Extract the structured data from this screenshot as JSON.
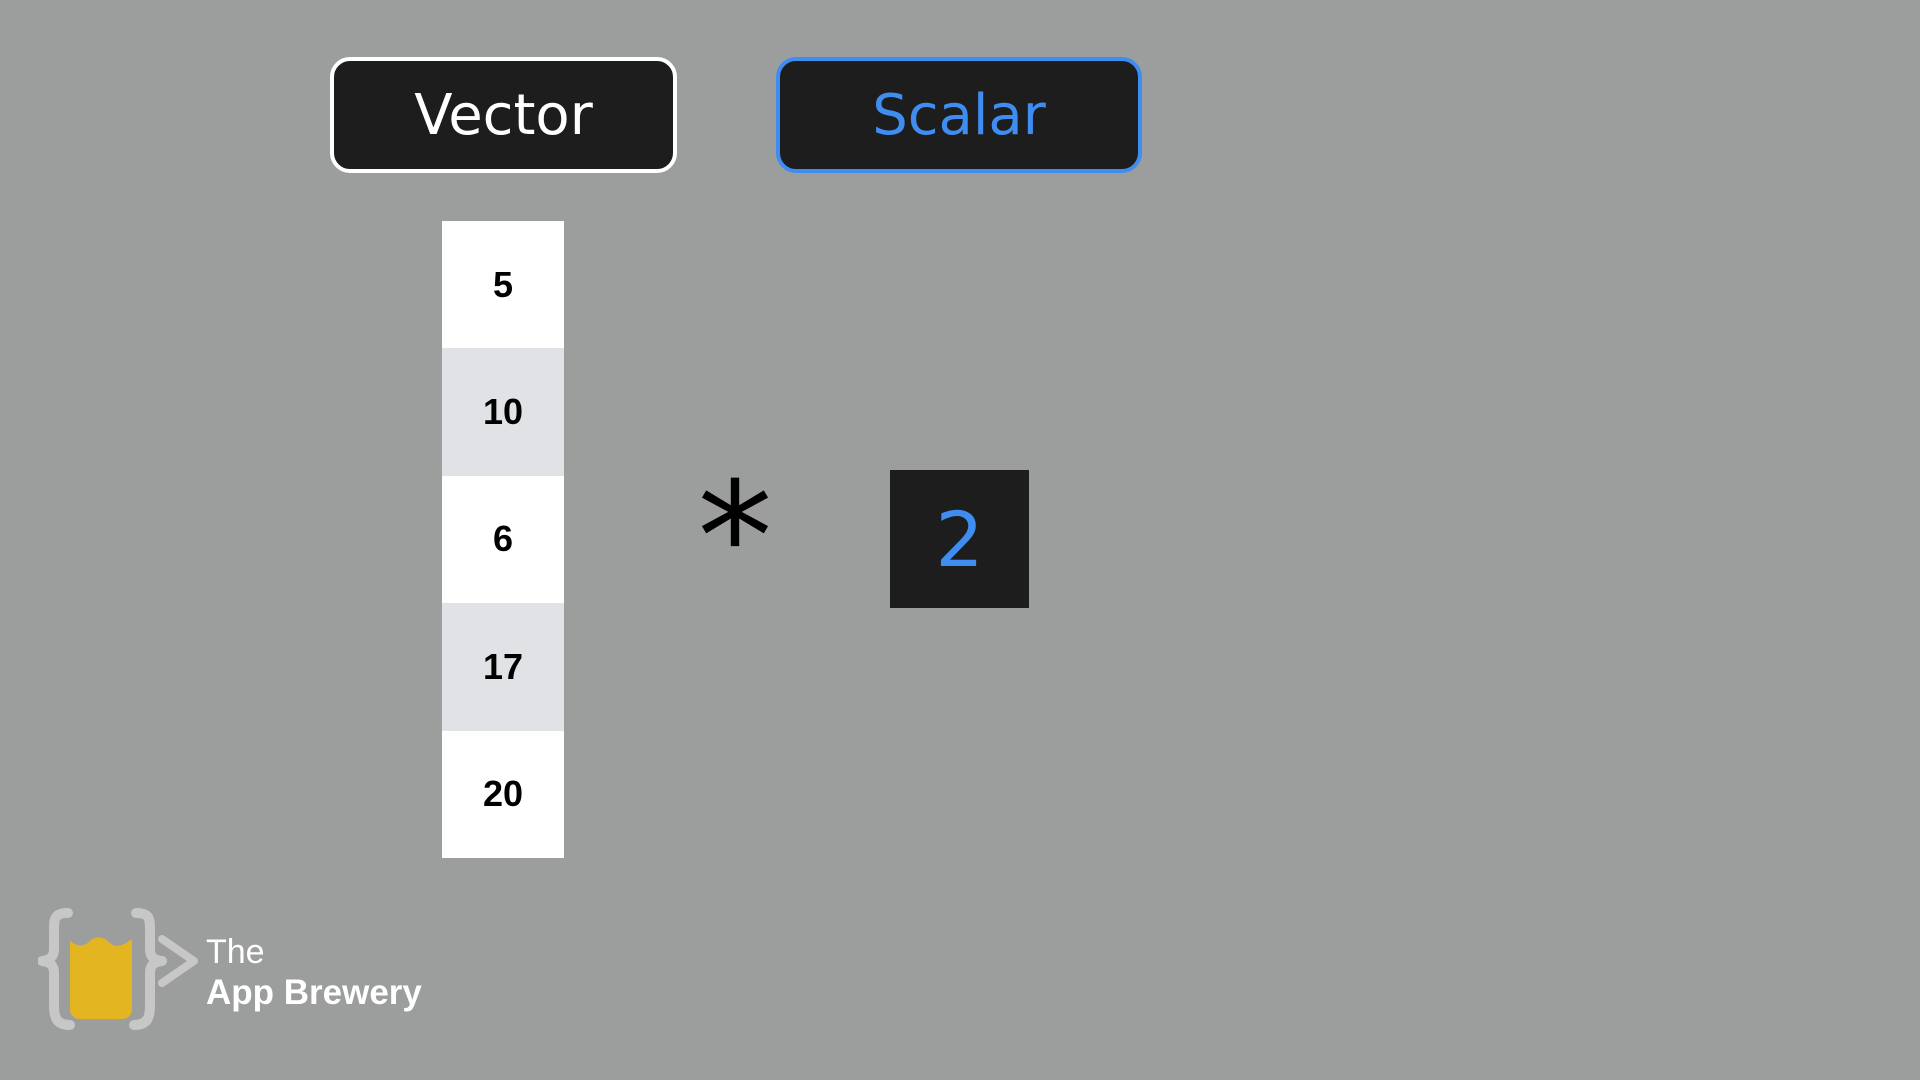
{
  "header": {
    "vector_label": "Vector",
    "scalar_label": "Scalar"
  },
  "vector": {
    "values": [
      "5",
      "10",
      "6",
      "17",
      "20"
    ]
  },
  "operation": {
    "symbol": "*"
  },
  "scalar": {
    "value": "2"
  },
  "logo": {
    "line1": "The",
    "line2": "App Brewery",
    "icon": "app-brewery-logo-icon"
  },
  "colors": {
    "background": "#9c9e9d",
    "box": "#1d1d1d",
    "accent_blue": "#3f8df0",
    "cell_alt": "#e1e2e6",
    "logo_yellow": "#e3b520",
    "logo_gray": "#c7c7c7"
  }
}
